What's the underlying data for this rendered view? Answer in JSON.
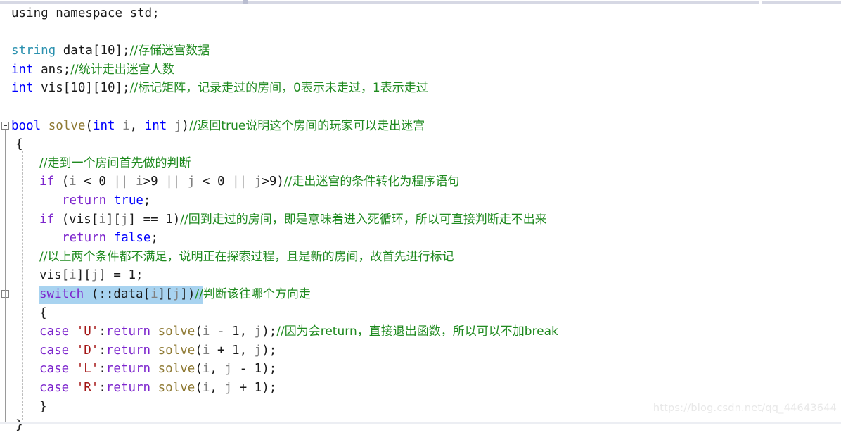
{
  "app": {
    "type": "code-editor",
    "language": "C++",
    "watermark": "https://blog.csdn.net/qq_44643644"
  },
  "colors": {
    "keyword": "#7d26cd",
    "type": "#0000ff",
    "class": "#2b91af",
    "function": "#8f7a34",
    "variable": "#808080",
    "comment": "#1f8a1f",
    "char_literal": "#a31515",
    "plain": "#1a1a1a",
    "selection": "#a8d3f0",
    "gutter_line": "#9a9a9a",
    "guide_dash": "#bdbdbd",
    "background": "#ffffff",
    "chrome_bar": "#d6d8e4",
    "watermark": "#e8e8e8"
  },
  "code": {
    "lines": [
      {
        "n": 1,
        "indent": 0,
        "tokens": [
          {
            "t": "using namespace ",
            "c": "plain"
          },
          {
            "t": "std",
            "c": "plain"
          },
          {
            "t": ";",
            "c": "plain"
          }
        ]
      },
      {
        "n": 2,
        "indent": 0,
        "tokens": []
      },
      {
        "n": 3,
        "indent": 0,
        "tokens": [
          {
            "t": "string",
            "c": "cls"
          },
          {
            "t": " data",
            "c": "plain"
          },
          {
            "t": "[",
            "c": "brk"
          },
          {
            "t": "10",
            "c": "num"
          },
          {
            "t": "]",
            "c": "brk"
          },
          {
            "t": ";",
            "c": "plain"
          },
          {
            "t": "//存储迷宫数据",
            "c": "cmt"
          }
        ]
      },
      {
        "n": 4,
        "indent": 0,
        "tokens": [
          {
            "t": "int",
            "c": "type"
          },
          {
            "t": " ans;",
            "c": "plain"
          },
          {
            "t": "//统计走出迷宫人数",
            "c": "cmt"
          }
        ]
      },
      {
        "n": 5,
        "indent": 0,
        "tokens": [
          {
            "t": "int",
            "c": "type"
          },
          {
            "t": " vis",
            "c": "plain"
          },
          {
            "t": "[",
            "c": "brk"
          },
          {
            "t": "10",
            "c": "num"
          },
          {
            "t": "][",
            "c": "brk"
          },
          {
            "t": "10",
            "c": "num"
          },
          {
            "t": "]",
            "c": "brk"
          },
          {
            "t": ";",
            "c": "plain"
          },
          {
            "t": "//标记矩阵，记录走过的房间，0表示未走过，1表示走过",
            "c": "cmt"
          }
        ]
      },
      {
        "n": 6,
        "indent": 0,
        "tokens": []
      },
      {
        "n": 7,
        "indent": 0,
        "fold": "open",
        "tokens": [
          {
            "t": "bool",
            "c": "type"
          },
          {
            "t": " ",
            "c": "plain"
          },
          {
            "t": "solve",
            "c": "fn"
          },
          {
            "t": "(",
            "c": "brk"
          },
          {
            "t": "int",
            "c": "type"
          },
          {
            "t": " ",
            "c": "plain"
          },
          {
            "t": "i",
            "c": "var"
          },
          {
            "t": ", ",
            "c": "plain"
          },
          {
            "t": "int",
            "c": "type"
          },
          {
            "t": " ",
            "c": "plain"
          },
          {
            "t": "j",
            "c": "var"
          },
          {
            "t": ")",
            "c": "brk"
          },
          {
            "t": "//返回true说明这个房间的玩家可以走出迷宫",
            "c": "cmt"
          }
        ]
      },
      {
        "n": 8,
        "indent": 1,
        "tokens": [
          {
            "t": "{",
            "c": "brk"
          }
        ]
      },
      {
        "n": 9,
        "indent": 2,
        "tokens": [
          {
            "t": "//走到一个房间首先做的判断",
            "c": "cmt"
          }
        ]
      },
      {
        "n": 10,
        "indent": 2,
        "tokens": [
          {
            "t": "if",
            "c": "kw"
          },
          {
            "t": " ",
            "c": "plain"
          },
          {
            "t": "(",
            "c": "brk"
          },
          {
            "t": "i",
            "c": "var"
          },
          {
            "t": " < ",
            "c": "op"
          },
          {
            "t": "0",
            "c": "num"
          },
          {
            "t": " ",
            "c": "plain"
          },
          {
            "t": "||",
            "c": "opg"
          },
          {
            "t": " ",
            "c": "plain"
          },
          {
            "t": "i",
            "c": "var"
          },
          {
            "t": ">",
            "c": "op"
          },
          {
            "t": "9",
            "c": "num"
          },
          {
            "t": " ",
            "c": "plain"
          },
          {
            "t": "||",
            "c": "opg"
          },
          {
            "t": " ",
            "c": "plain"
          },
          {
            "t": "j",
            "c": "var"
          },
          {
            "t": " < ",
            "c": "op"
          },
          {
            "t": "0",
            "c": "num"
          },
          {
            "t": " ",
            "c": "plain"
          },
          {
            "t": "||",
            "c": "opg"
          },
          {
            "t": " ",
            "c": "plain"
          },
          {
            "t": "j",
            "c": "var"
          },
          {
            "t": ">",
            "c": "op"
          },
          {
            "t": "9",
            "c": "num"
          },
          {
            "t": ")",
            "c": "brk"
          },
          {
            "t": "//走出迷宫的条件转化为程序语句",
            "c": "cmt"
          }
        ]
      },
      {
        "n": 11,
        "indent": 3,
        "tokens": [
          {
            "t": "return",
            "c": "kw"
          },
          {
            "t": " ",
            "c": "plain"
          },
          {
            "t": "true",
            "c": "type"
          },
          {
            "t": ";",
            "c": "plain"
          }
        ]
      },
      {
        "n": 12,
        "indent": 2,
        "tokens": [
          {
            "t": "if",
            "c": "kw"
          },
          {
            "t": " ",
            "c": "plain"
          },
          {
            "t": "(",
            "c": "brk"
          },
          {
            "t": "vis",
            "c": "plain"
          },
          {
            "t": "[",
            "c": "brk"
          },
          {
            "t": "i",
            "c": "var"
          },
          {
            "t": "][",
            "c": "brk"
          },
          {
            "t": "j",
            "c": "var"
          },
          {
            "t": "]",
            "c": "brk"
          },
          {
            "t": " == ",
            "c": "op"
          },
          {
            "t": "1",
            "c": "num"
          },
          {
            "t": ")",
            "c": "brk"
          },
          {
            "t": "//回到走过的房间，即是意味着进入死循环，所以可直接判断走不出来",
            "c": "cmt"
          }
        ]
      },
      {
        "n": 13,
        "indent": 3,
        "tokens": [
          {
            "t": "return",
            "c": "kw"
          },
          {
            "t": " ",
            "c": "plain"
          },
          {
            "t": "false",
            "c": "type"
          },
          {
            "t": ";",
            "c": "plain"
          }
        ]
      },
      {
        "n": 14,
        "indent": 2,
        "tokens": [
          {
            "t": "//以上两个条件都不满足，说明正在探索过程，且是新的房间，故首先进行标记",
            "c": "cmt"
          }
        ]
      },
      {
        "n": 15,
        "indent": 2,
        "tokens": [
          {
            "t": "vis",
            "c": "plain"
          },
          {
            "t": "[",
            "c": "brk"
          },
          {
            "t": "i",
            "c": "var"
          },
          {
            "t": "][",
            "c": "brk"
          },
          {
            "t": "j",
            "c": "var"
          },
          {
            "t": "]",
            "c": "brk"
          },
          {
            "t": " = ",
            "c": "op"
          },
          {
            "t": "1",
            "c": "num"
          },
          {
            "t": ";",
            "c": "plain"
          }
        ]
      },
      {
        "n": 16,
        "indent": 2,
        "fold": "open",
        "selected": true,
        "tokens": [
          {
            "t": "switch",
            "c": "kw"
          },
          {
            "t": " ",
            "c": "plain"
          },
          {
            "t": "(",
            "c": "brk"
          },
          {
            "t": "::",
            "c": "plain"
          },
          {
            "t": "data",
            "c": "plain"
          },
          {
            "t": "[",
            "c": "brk"
          },
          {
            "t": "i",
            "c": "var"
          },
          {
            "t": "][",
            "c": "brk"
          },
          {
            "t": "j",
            "c": "var"
          },
          {
            "t": "]",
            "c": "brk"
          },
          {
            "t": ")",
            "c": "brk"
          },
          {
            "t": "//判断该往哪个方向走",
            "c": "cmt"
          }
        ]
      },
      {
        "n": 17,
        "indent": 2,
        "tokens": [
          {
            "t": "{",
            "c": "brk"
          }
        ]
      },
      {
        "n": 18,
        "indent": 2,
        "tokens": [
          {
            "t": "case",
            "c": "kw"
          },
          {
            "t": " ",
            "c": "plain"
          },
          {
            "t": "'U'",
            "c": "chr"
          },
          {
            "t": ":",
            "c": "plain"
          },
          {
            "t": "return",
            "c": "kw"
          },
          {
            "t": " ",
            "c": "plain"
          },
          {
            "t": "solve",
            "c": "fn"
          },
          {
            "t": "(",
            "c": "brk"
          },
          {
            "t": "i",
            "c": "var"
          },
          {
            "t": " - ",
            "c": "op"
          },
          {
            "t": "1",
            "c": "num"
          },
          {
            "t": ", ",
            "c": "plain"
          },
          {
            "t": "j",
            "c": "var"
          },
          {
            "t": ")",
            "c": "brk"
          },
          {
            "t": ";",
            "c": "plain"
          },
          {
            "t": "//因为会return，直接退出函数，所以可以不加break",
            "c": "cmt"
          }
        ]
      },
      {
        "n": 19,
        "indent": 2,
        "tokens": [
          {
            "t": "case",
            "c": "kw"
          },
          {
            "t": " ",
            "c": "plain"
          },
          {
            "t": "'D'",
            "c": "chr"
          },
          {
            "t": ":",
            "c": "plain"
          },
          {
            "t": "return",
            "c": "kw"
          },
          {
            "t": " ",
            "c": "plain"
          },
          {
            "t": "solve",
            "c": "fn"
          },
          {
            "t": "(",
            "c": "brk"
          },
          {
            "t": "i",
            "c": "var"
          },
          {
            "t": " + ",
            "c": "op"
          },
          {
            "t": "1",
            "c": "num"
          },
          {
            "t": ", ",
            "c": "plain"
          },
          {
            "t": "j",
            "c": "var"
          },
          {
            "t": ")",
            "c": "brk"
          },
          {
            "t": ";",
            "c": "plain"
          }
        ]
      },
      {
        "n": 20,
        "indent": 2,
        "tokens": [
          {
            "t": "case",
            "c": "kw"
          },
          {
            "t": " ",
            "c": "plain"
          },
          {
            "t": "'L'",
            "c": "chr"
          },
          {
            "t": ":",
            "c": "plain"
          },
          {
            "t": "return",
            "c": "kw"
          },
          {
            "t": " ",
            "c": "plain"
          },
          {
            "t": "solve",
            "c": "fn"
          },
          {
            "t": "(",
            "c": "brk"
          },
          {
            "t": "i",
            "c": "var"
          },
          {
            "t": ", ",
            "c": "plain"
          },
          {
            "t": "j",
            "c": "var"
          },
          {
            "t": " - ",
            "c": "op"
          },
          {
            "t": "1",
            "c": "num"
          },
          {
            "t": ")",
            "c": "brk"
          },
          {
            "t": ";",
            "c": "plain"
          }
        ]
      },
      {
        "n": 21,
        "indent": 2,
        "tokens": [
          {
            "t": "case",
            "c": "kw"
          },
          {
            "t": " ",
            "c": "plain"
          },
          {
            "t": "'R'",
            "c": "chr"
          },
          {
            "t": ":",
            "c": "plain"
          },
          {
            "t": "return",
            "c": "kw"
          },
          {
            "t": " ",
            "c": "plain"
          },
          {
            "t": "solve",
            "c": "fn"
          },
          {
            "t": "(",
            "c": "brk"
          },
          {
            "t": "i",
            "c": "var"
          },
          {
            "t": ", ",
            "c": "plain"
          },
          {
            "t": "j",
            "c": "var"
          },
          {
            "t": " + ",
            "c": "op"
          },
          {
            "t": "1",
            "c": "num"
          },
          {
            "t": ")",
            "c": "brk"
          },
          {
            "t": ";",
            "c": "plain"
          }
        ]
      },
      {
        "n": 22,
        "indent": 2,
        "tokens": [
          {
            "t": "}",
            "c": "brk"
          }
        ]
      },
      {
        "n": 23,
        "indent": 1,
        "tokens": [
          {
            "t": "}",
            "c": "brk"
          }
        ]
      }
    ]
  }
}
